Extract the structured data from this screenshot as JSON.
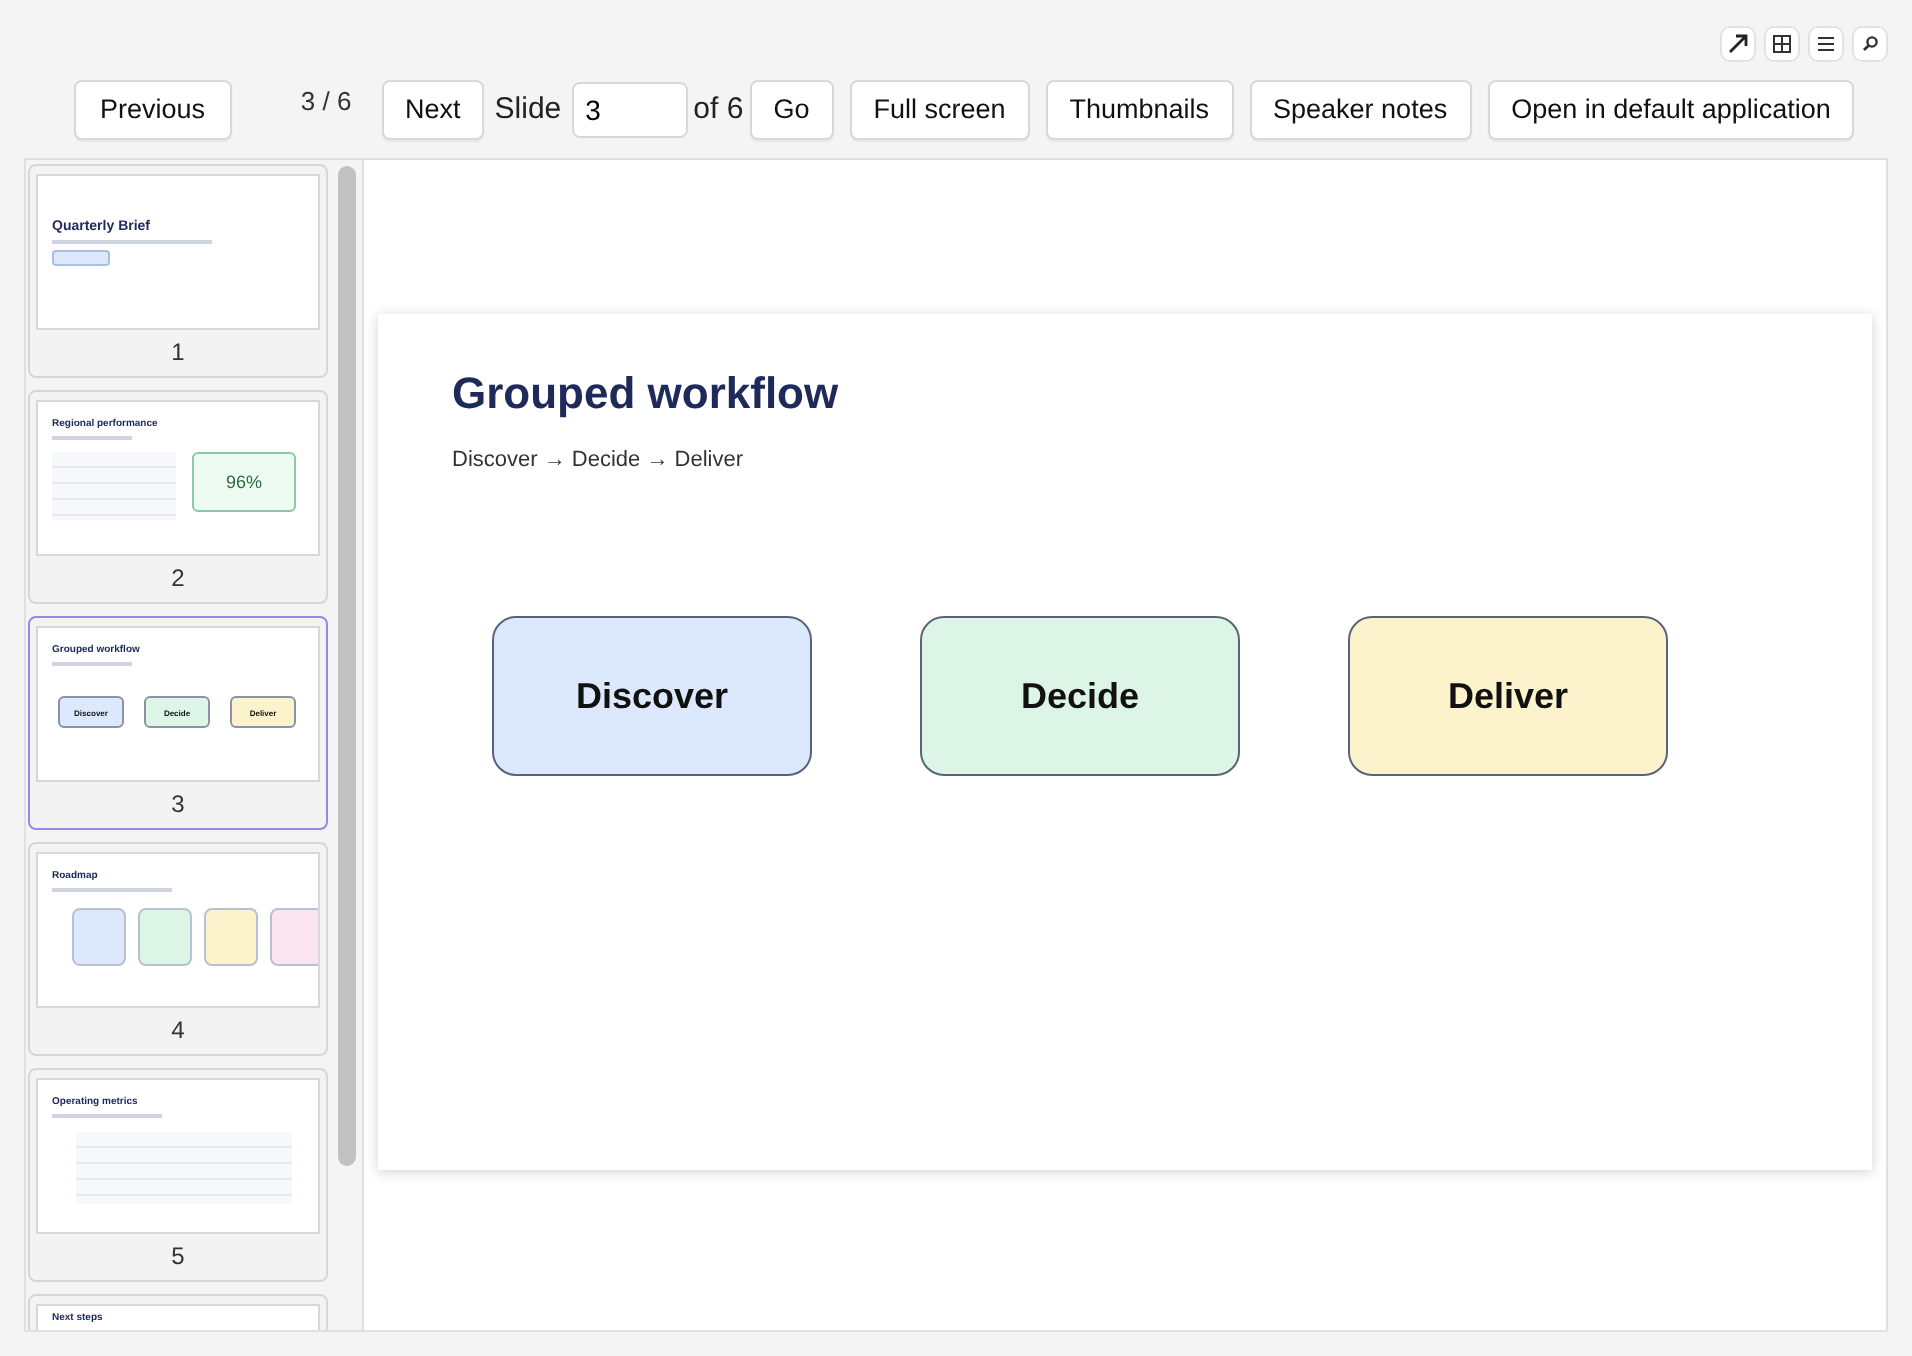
{
  "corner_tools": [
    {
      "kind": "expand"
    },
    {
      "kind": "grid"
    },
    {
      "kind": "list"
    },
    {
      "kind": "search"
    }
  ],
  "toolbar": {
    "previous": "Previous",
    "position": "3 / 6",
    "next": "Next",
    "slide_label": "Slide",
    "slide_value": "3",
    "of_label": "of 6",
    "go": "Go",
    "buttons": [
      "Full screen",
      "Thumbnails",
      "Speaker notes",
      "Open in default application"
    ]
  },
  "thumbnails": [
    {
      "number": "1",
      "kind": "title",
      "title": "Quarterly Brief",
      "selected": false
    },
    {
      "number": "2",
      "kind": "table-stat",
      "title": "Regional performance",
      "stat": "96%",
      "selected": false
    },
    {
      "number": "3",
      "kind": "boxes",
      "title": "Grouped workflow",
      "boxes": [
        {
          "label": "Discover",
          "color": "#dce8fb"
        },
        {
          "label": "Decide",
          "color": "#dcf5e6"
        },
        {
          "label": "Deliver",
          "color": "#fcf3cc"
        }
      ],
      "selected": true
    },
    {
      "number": "4",
      "kind": "cards",
      "title": "Roadmap",
      "selected": false
    },
    {
      "number": "5",
      "kind": "table",
      "title": "Operating metrics",
      "selected": false
    },
    {
      "kind": "heading",
      "title": "Next steps",
      "selected": false
    }
  ],
  "slide": {
    "title": "Grouped workflow",
    "subtitle": "Discover → Decide → Deliver",
    "boxes": [
      {
        "label": "Discover",
        "color": "#dce8fb"
      },
      {
        "label": "Decide",
        "color": "#dcf5e6"
      },
      {
        "label": "Deliver",
        "color": "#fcf3cc"
      }
    ]
  }
}
